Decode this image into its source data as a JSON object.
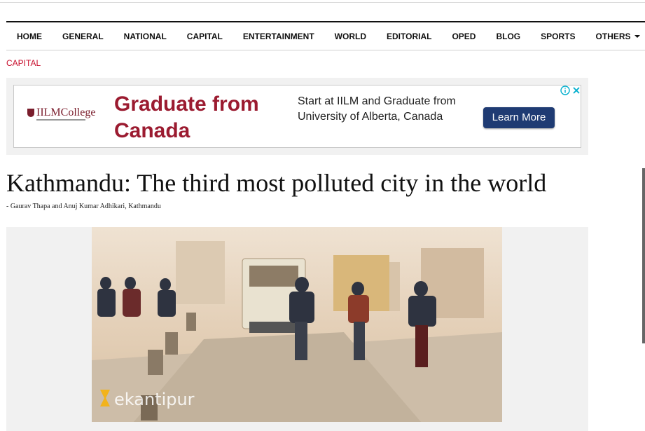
{
  "nav": {
    "items": [
      {
        "label": "HOME"
      },
      {
        "label": "GENERAL"
      },
      {
        "label": "NATIONAL"
      },
      {
        "label": "CAPITAL"
      },
      {
        "label": "ENTERTAINMENT"
      },
      {
        "label": "WORLD"
      },
      {
        "label": "EDITORIAL"
      },
      {
        "label": "OPED"
      },
      {
        "label": "BLOG"
      },
      {
        "label": "SPORTS"
      },
      {
        "label": "OTHERS"
      }
    ]
  },
  "category": "CAPITAL",
  "ad": {
    "logo_text": "IILMCollege",
    "headline": "Graduate from Canada",
    "body": "Start at IILM and Graduate from University of Alberta, Canada",
    "cta": "Learn More",
    "info_icon": "info-icon",
    "close_icon": "close-icon"
  },
  "article": {
    "title": "Kathmandu: The third most polluted city in the world",
    "byline": "- Gaurav Thapa and Anuj Kumar Adhikari, Kathmandu"
  },
  "photo": {
    "watermark": "ekantipur"
  },
  "colors": {
    "accent": "#c8102e",
    "ad_headline": "#9b1b30",
    "cta_bg": "#1f3b73"
  }
}
